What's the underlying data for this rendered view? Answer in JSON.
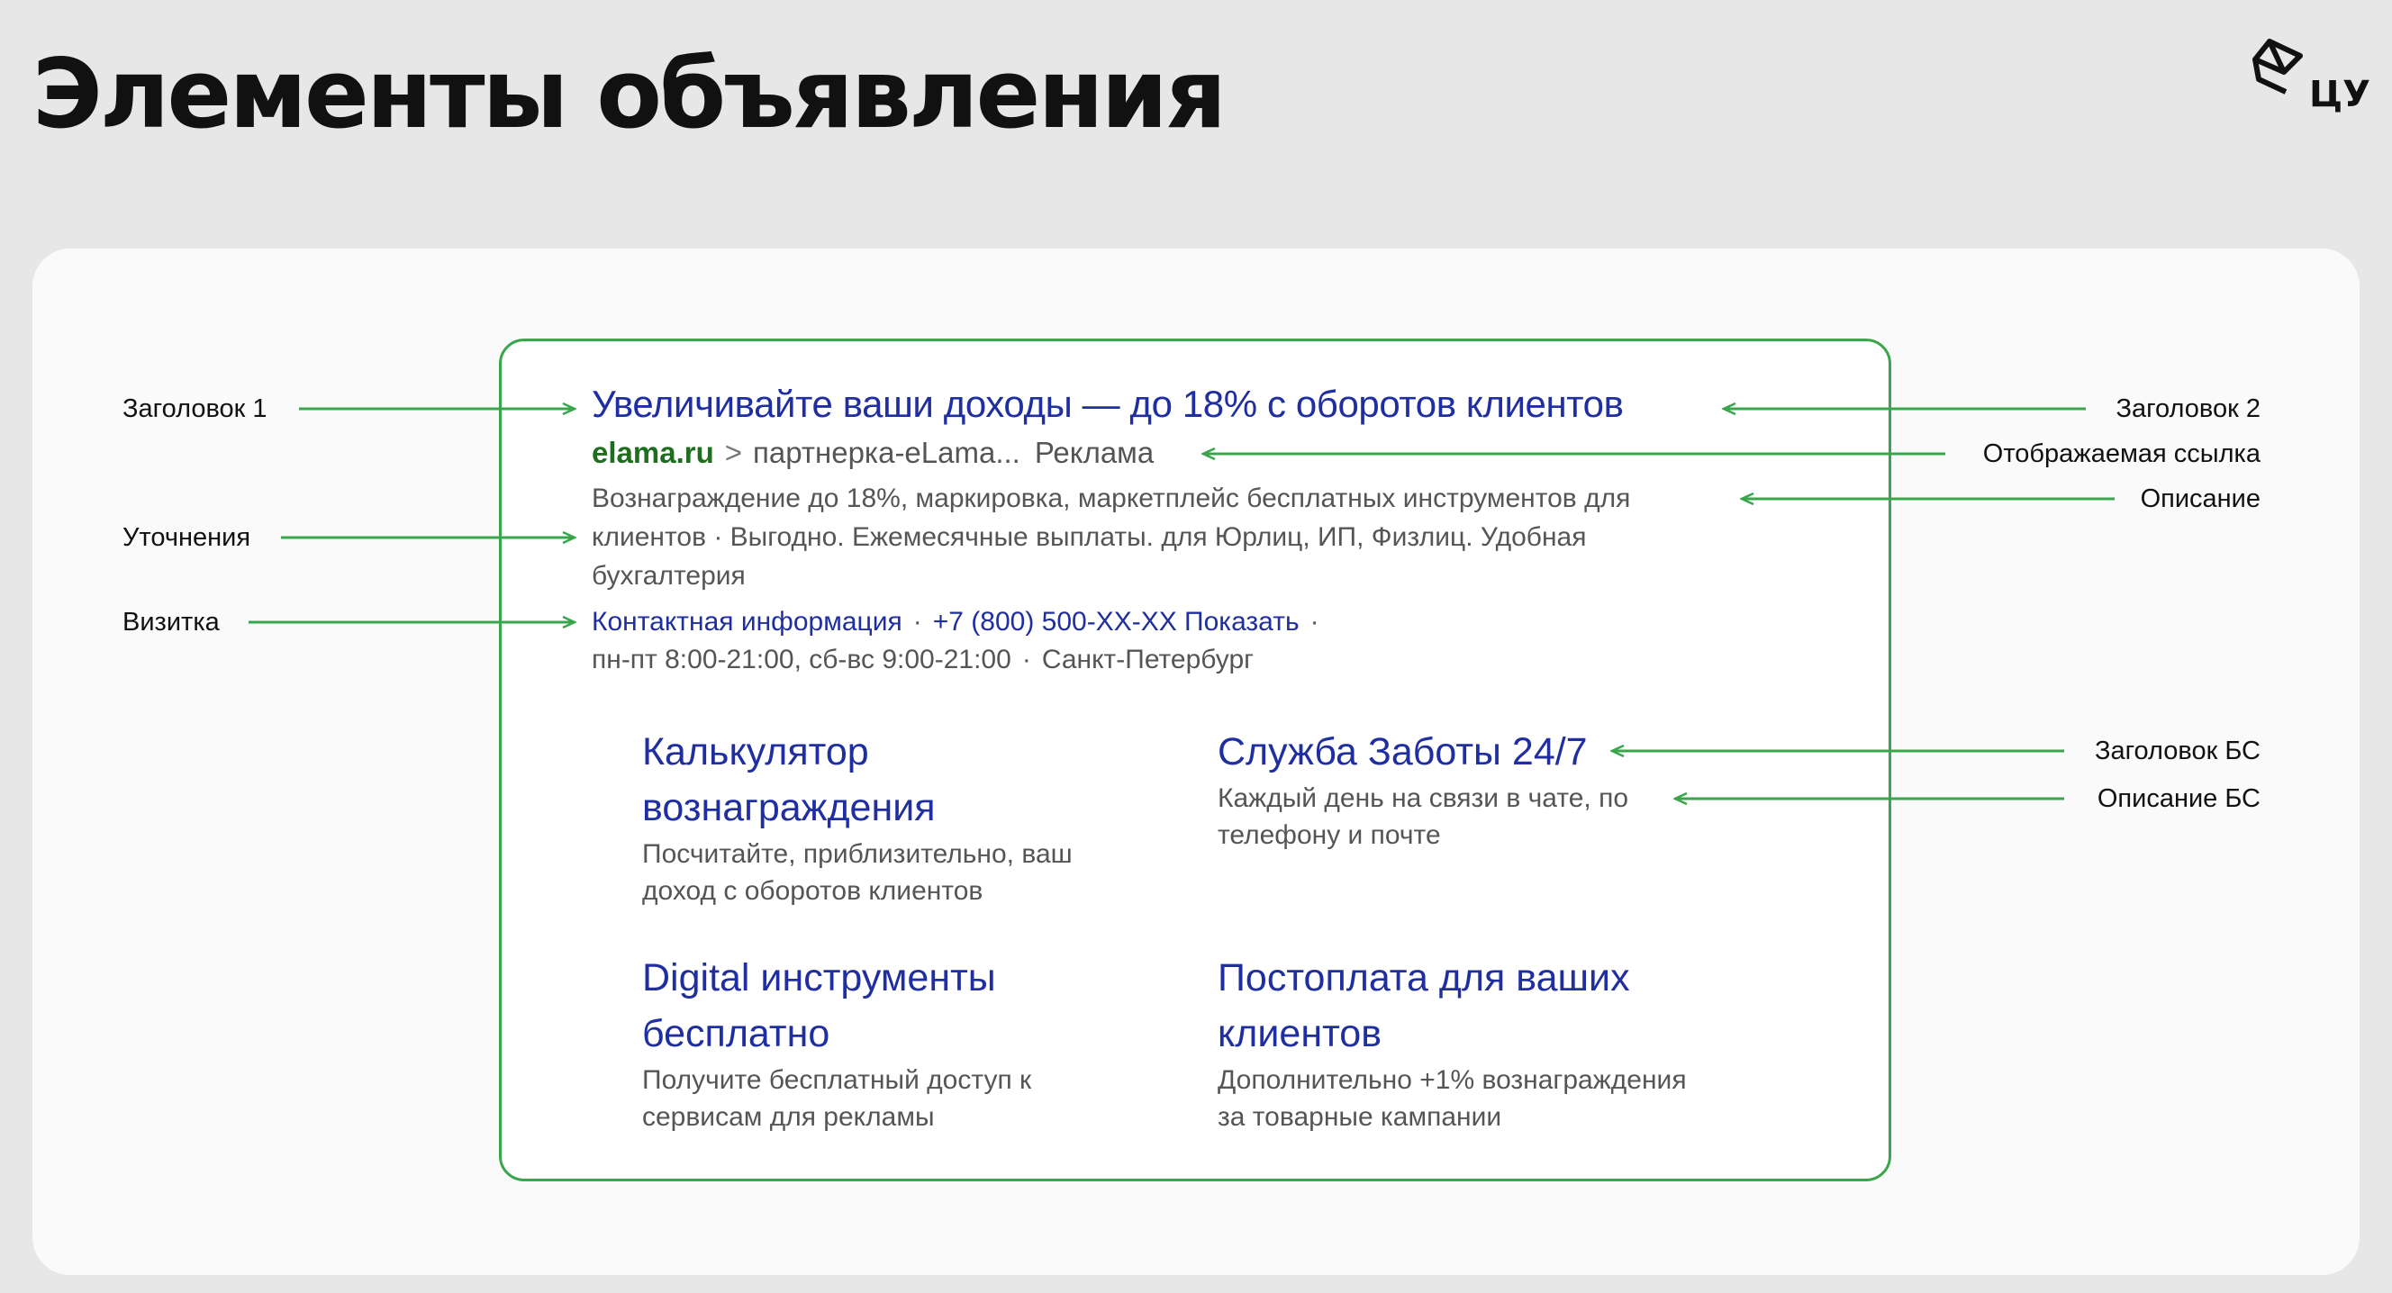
{
  "page": {
    "title": "Элементы объявления",
    "logo_text": "ЦУ"
  },
  "labels": {
    "headline1": "Заголовок 1",
    "refinements": "Уточнения",
    "vcard": "Визитка",
    "headline2": "Заголовок 2",
    "display_link": "Отображаемая ссылка",
    "description": "Описание",
    "sitelink_title": "Заголовок БС",
    "sitelink_description": "Описание БС"
  },
  "ad": {
    "title": "Увеличивайте ваши доходы — до 18% с оборотов клиентов",
    "domain": "elama.ru",
    "separator": ">",
    "path": "партнерка-eLama...",
    "badge": "Реклама",
    "description_lines": [
      "Вознаграждение до 18%, маркировка, маркетплейс бесплатных инструментов для",
      "клиентов · Выгодно. Ежемесячные выплаты. для Юрлиц, ИП, Физлиц. Удобная",
      "бухгалтерия"
    ],
    "vcard": {
      "contact": "Контактная информация",
      "phone": "+7 (800) 500-ХХ-ХХ Показать",
      "hours": "пн-пт 8:00-21:00, сб-вс 9:00-21:00",
      "city": "Санкт-Петербург",
      "dot": "·"
    },
    "sitelinks": [
      {
        "title_lines": [
          "Калькулятор",
          "вознаграждения"
        ],
        "desc_lines": [
          "Посчитайте, приблизительно, ваш",
          "доход с оборотов клиентов"
        ]
      },
      {
        "title_lines": [
          "Служба Заботы 24/7"
        ],
        "desc_lines": [
          "Каждый день на связи в чате, по",
          "телефону и почте"
        ]
      },
      {
        "title_lines": [
          "Digital инструменты",
          "бесплатно"
        ],
        "desc_lines": [
          "Получите бесплатный доступ к",
          "сервисам для рекламы"
        ]
      },
      {
        "title_lines": [
          "Постоплата для ваших",
          "клиентов"
        ],
        "desc_lines": [
          "Дополнительно +1% вознаграждения",
          "за товарные кампании"
        ]
      }
    ]
  },
  "colors": {
    "accent_green": "#3aa64c",
    "ad_blue": "#1f2ea0",
    "domain_green": "#1f6e1f",
    "text_gray": "#555555",
    "background": "#e7e7e7",
    "panel": "#fafafa"
  }
}
